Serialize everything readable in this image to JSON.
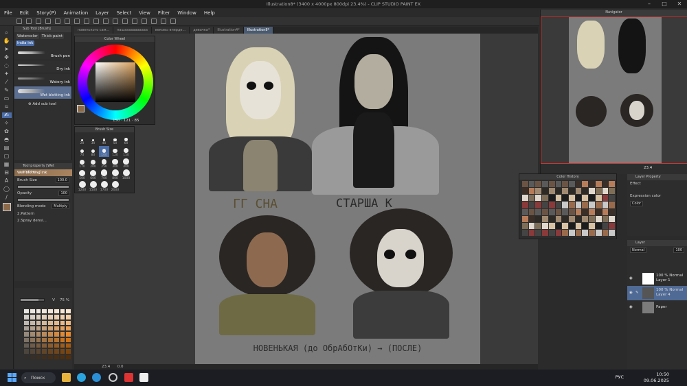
{
  "window": {
    "title": "Illustration8* (3400 x 4000px 800dpi 23.4%) - CLIP STUDIO PAINT EX"
  },
  "menu": [
    "File",
    "Edit",
    "Story(P)",
    "Animation",
    "Layer",
    "Select",
    "View",
    "Filter",
    "Window",
    "Help"
  ],
  "doc_tabs": [
    {
      "label": "новенького сам..."
    },
    {
      "label": "пашааааааааааа"
    },
    {
      "label": "вековы вперде..."
    },
    {
      "label": "девачка*"
    },
    {
      "label": "Illustration4*"
    },
    {
      "label": "Illustration8*",
      "active": true
    }
  ],
  "subtool": {
    "title": "Sub Tool [Brush]",
    "tabs": [
      "Watercolor",
      "Thick paint",
      "India ink"
    ],
    "active_tab": "India ink",
    "brushes": [
      "Brush pen",
      "Dry ink",
      "Watery ink",
      "Wet blotting ink"
    ],
    "active_brush": "Wet blotting ink",
    "add_label": "Add sub tool"
  },
  "tool_property": {
    "title": "Tool property [Wet blotting...]",
    "brush_name": "Wet blotting ink",
    "brush_size_label": "Brush Size",
    "brush_size": "100.0",
    "opacity_label": "Opacity",
    "opacity": "100",
    "blending_label": "Blending mode",
    "blending": "Multiply",
    "p1": "2.Pattern",
    "p2": "2.Spray densi..."
  },
  "color_set": {
    "v_label": "V",
    "v_value": "75 %"
  },
  "color_wheel": {
    "title": "Color Wheel",
    "h": "150",
    "s": "121",
    "v": "85"
  },
  "brush_size_palette": {
    "title": "Brush Size",
    "sizes": [
      "20",
      "30",
      "40",
      "50",
      "60",
      "70",
      "80",
      "100",
      "120",
      "150",
      "170",
      "200",
      "250",
      "300",
      "400",
      "500",
      "600",
      "700",
      "800",
      "1000",
      "1200",
      "1500",
      "1700",
      "2000"
    ],
    "active": "100"
  },
  "artwork": {
    "label_top_left": "ГГ СНА",
    "label_top_right": "СТАРША К",
    "label_bottom": "НОВЕНЬКАЯ (до ОбрАбОтКи) → (ПОСЛЕ)"
  },
  "statusbar": {
    "zoom": "23.4",
    "angle": "0.0"
  },
  "navigator": {
    "title": "Navigator",
    "zoom": "23.4",
    "angle": "0.0"
  },
  "color_history": {
    "title": "Color History"
  },
  "layer_property": {
    "title": "Layer Property",
    "effect_label": "Effect",
    "expression_label": "Expression color",
    "expression_value": "Color"
  },
  "layer_panel": {
    "title": "Layer",
    "blend": "Normal",
    "opacity": "100",
    "layers": [
      {
        "opacity": "100 %",
        "mode": "Normal",
        "name": "Layer 1"
      },
      {
        "opacity": "100 %",
        "mode": "Normal",
        "name": "Layer 4",
        "active": true
      },
      {
        "name": "Paper"
      }
    ]
  },
  "taskbar": {
    "search": "Поиск",
    "lang": "РУС",
    "time": "10:50",
    "date": "09.06.2025"
  },
  "colors": {
    "accent": "#4b6ea8",
    "selection": "#4f6a95",
    "canvas_bg": "#7b7b7b"
  }
}
